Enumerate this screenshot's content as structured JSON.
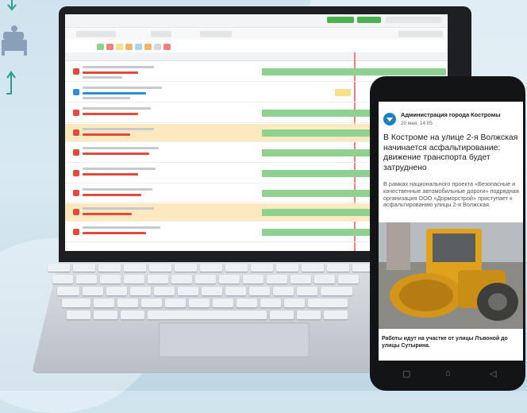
{
  "phone_post": {
    "organization": "Администрация города Костромы",
    "date": "20 мая, 14:05",
    "title": "В Костроме на улице 2-я Волжская начинается асфальтирование: движение транспорта будет затруднено",
    "lead": "В рамках национального проекта «Безопасные и качественные автомобильные дороги» подрядная организация ООО «Дорморстрой» приступает к асфальтированию улицы 2-я Волжская.",
    "caption": "Работы идут на участке от улицы Лъвоной до улицы Сутырина."
  },
  "colors": {
    "accent_green": "#4caf50",
    "gantt_green": "#8fd18f",
    "gantt_yellow": "#f7e08a",
    "row_highlight": "#fde9bf",
    "red_icon": "#e24b3b",
    "blue_icon": "#2f8fd6",
    "avatar_blue": "#1d7fbe"
  },
  "icons": [
    "reload-icon",
    "bed-icon",
    "arrow-down-icon",
    "arrow-up-icon",
    "vk-logo-icon",
    "back-nav-icon",
    "home-nav-icon",
    "recent-nav-icon"
  ]
}
